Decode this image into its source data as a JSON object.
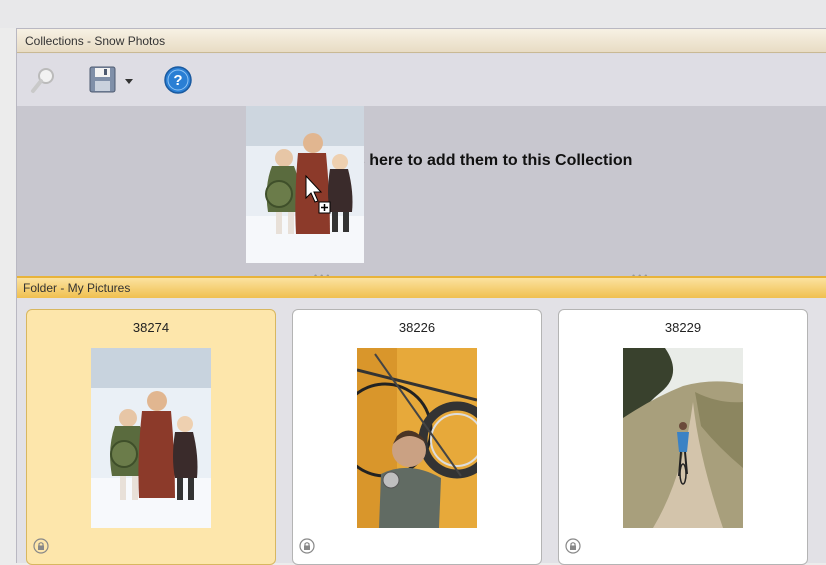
{
  "collections_panel": {
    "title": "Collections - Snow Photos",
    "drop_hint": "es here to add them to this Collection"
  },
  "toolbar": {
    "buttons": [
      {
        "icon": "magnifier-icon"
      },
      {
        "icon": "save-icon"
      },
      {
        "icon": "dropdown-arrow-icon"
      },
      {
        "icon": "help-icon"
      }
    ]
  },
  "folder_panel": {
    "title": "Folder - My Pictures",
    "items": [
      {
        "name": "38274",
        "selected": true,
        "locked": true
      },
      {
        "name": "38226",
        "selected": false,
        "locked": true
      },
      {
        "name": "38229",
        "selected": false,
        "locked": true
      }
    ]
  },
  "colors": {
    "selected_card": "#fde6ab",
    "folder_header": "#f0c050",
    "help_blue": "#2a7fd4"
  }
}
